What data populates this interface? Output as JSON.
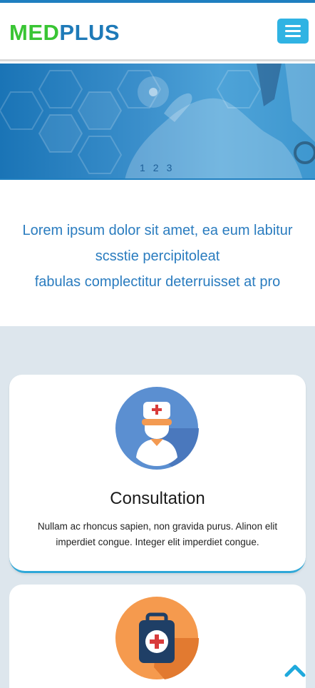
{
  "header": {
    "logo_part1": "MED",
    "logo_part2": "PLUS",
    "menu_icon": "hamburger-icon"
  },
  "hero": {
    "slides": [
      "1",
      "2",
      "3"
    ],
    "active_slide": 1
  },
  "intro": {
    "line1": "Lorem ipsum dolor sit amet, ea eum labitur",
    "line2": "scsstie percipitoleat",
    "line3": "fabulas complectitur deterruisset at pro"
  },
  "services": [
    {
      "icon": "nurse-icon",
      "title": "Consultation",
      "text": "Nullam ac rhoncus sapien, non gravida purus. Alinon elit imperdiet congue. Integer elit imperdiet congue."
    },
    {
      "icon": "medical-kit-icon",
      "title": "",
      "text": ""
    }
  ],
  "colors": {
    "brand_green": "#39c534",
    "brand_blue": "#1e7ab8",
    "accent": "#30b3e3",
    "section_bg": "#dde6ed"
  },
  "scroll_top_icon": "chevron-up-icon"
}
